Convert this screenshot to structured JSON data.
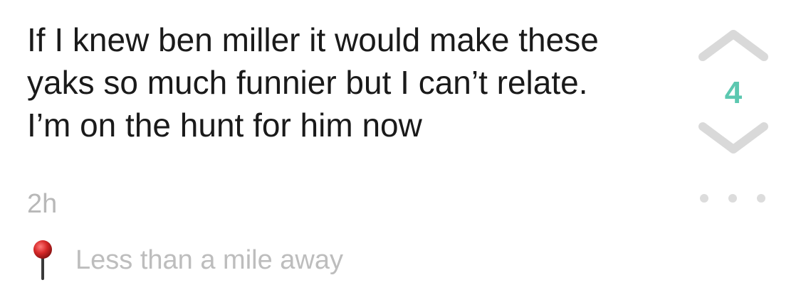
{
  "post": {
    "lines": [
      "If I knew ben miller it would make these",
      "yaks so much funnier but I can’t relate.",
      "I’m on the hunt for him now"
    ],
    "time": "2h",
    "location": "Less than a mile away"
  },
  "vote": {
    "count": "4",
    "up_icon": "chevron-up-icon",
    "down_icon": "chevron-down-icon"
  },
  "more": {
    "icon": "more-dots-icon"
  },
  "colors": {
    "text": "#1a1a1a",
    "count": "#5cc8b0",
    "chevron": "#d9d9d9",
    "muted": "#b8b8b8",
    "pin": "#d62828"
  }
}
